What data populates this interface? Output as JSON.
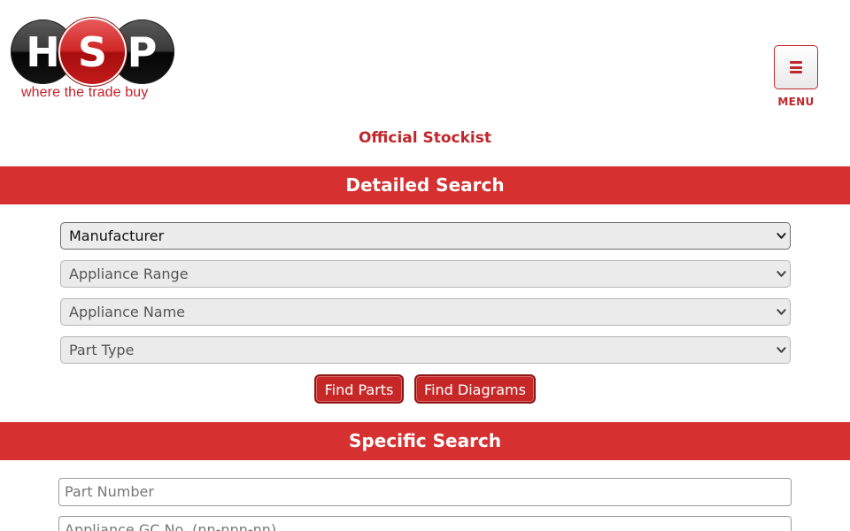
{
  "logo": {
    "letters": [
      "H",
      "S",
      "P"
    ],
    "tagline": "where the trade buy"
  },
  "menu": {
    "icon": "hamburger-icon",
    "label": "MENU"
  },
  "official_stockist": "Official Stockist",
  "detailed_search": {
    "title": "Detailed Search",
    "selects": [
      {
        "value": "Manufacturer"
      },
      {
        "value": "Appliance Range"
      },
      {
        "value": "Appliance Name"
      },
      {
        "value": "Part Type"
      }
    ],
    "buttons": {
      "find_parts": "Find Parts",
      "find_diagrams": "Find Diagrams"
    }
  },
  "specific_search": {
    "title": "Specific Search",
    "part_number_placeholder": "Part Number",
    "gc_number_placeholder": "Appliance GC No. (nn-nnn-nn)"
  },
  "colors": {
    "brand_red": "#d63031",
    "logo_dark": "#141414"
  }
}
